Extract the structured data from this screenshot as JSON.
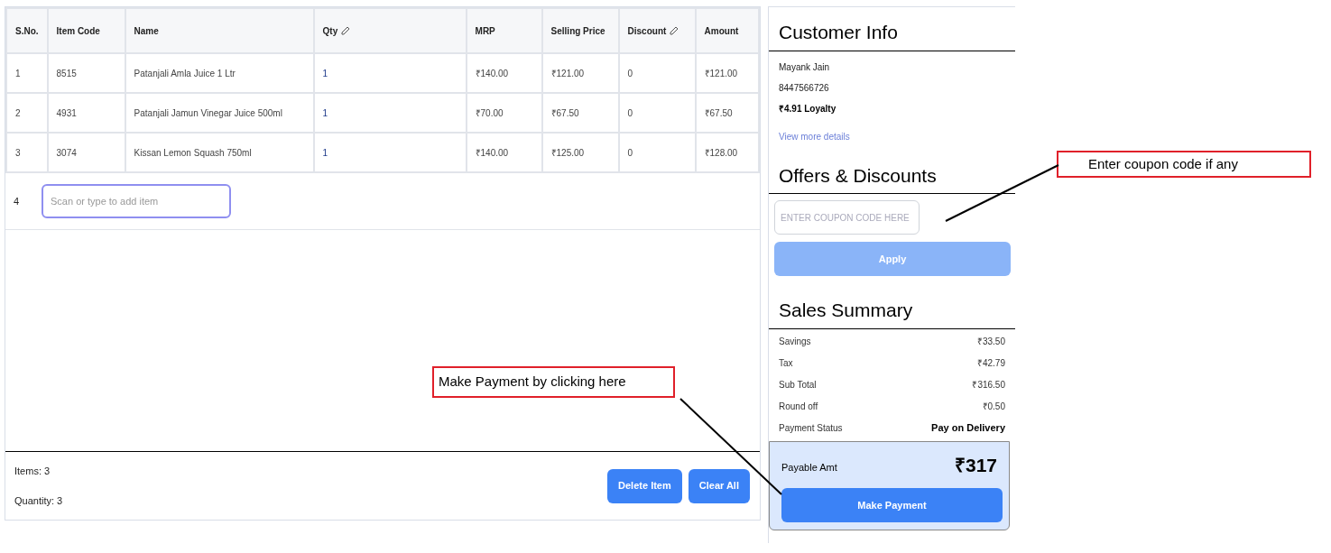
{
  "table": {
    "columns": [
      {
        "label": "S.No.",
        "editable": false
      },
      {
        "label": "Item Code",
        "editable": false
      },
      {
        "label": "Name",
        "editable": false
      },
      {
        "label": "Qty",
        "editable": true
      },
      {
        "label": "MRP",
        "editable": false
      },
      {
        "label": "Selling Price",
        "editable": false
      },
      {
        "label": "Discount",
        "editable": true
      },
      {
        "label": "Amount",
        "editable": false
      }
    ],
    "rows": [
      [
        "1",
        "8515",
        "Patanjali Amla Juice 1 Ltr",
        "1",
        "₹140.00",
        "₹121.00",
        "0",
        "₹121.00"
      ],
      [
        "2",
        "4931",
        "Patanjali Jamun Vinegar Juice 500ml",
        "1",
        "₹70.00",
        "₹67.50",
        "0",
        "₹67.50"
      ],
      [
        "3",
        "3074",
        "Kissan Lemon Squash 750ml",
        "1",
        "₹140.00",
        "₹125.00",
        "0",
        "₹128.00"
      ]
    ],
    "new_row": {
      "number": "4",
      "placeholder": "Scan or type to add item"
    }
  },
  "footer": {
    "items": "Items: 3",
    "quantity": "Quantity: 3",
    "buttons": [
      "Delete Item",
      "Clear All"
    ]
  },
  "customer_info": {
    "title": "Customer Info",
    "name": "Mayank Jain",
    "phone": "8447566726",
    "loyalty": "₹4.91 Loyalty",
    "link": "View more details"
  },
  "offers": {
    "title": "Offers & Discounts",
    "placeholder": "ENTER COUPON CODE HERE",
    "button": "Apply",
    "button_disabled": true
  },
  "sales_summary": {
    "title": "Sales Summary",
    "rows": [
      {
        "label": "Savings",
        "value": "₹33.50",
        "kind": "plain"
      },
      {
        "label": "Tax",
        "value": "₹42.79",
        "kind": "plain"
      },
      {
        "label": "Sub Total",
        "value": "₹316.50",
        "kind": "plain"
      },
      {
        "label": "Round off",
        "value": "₹0.50",
        "kind": "plain"
      },
      {
        "label": "Payment Status",
        "value": "Pay on Delivery",
        "kind": "status"
      }
    ],
    "payable_label": "Payable Amt",
    "payable_amount": "₹317",
    "button": "Make Payment"
  },
  "annotations": [
    "Enter coupon code if any",
    "Make Payment by clicking here"
  ]
}
